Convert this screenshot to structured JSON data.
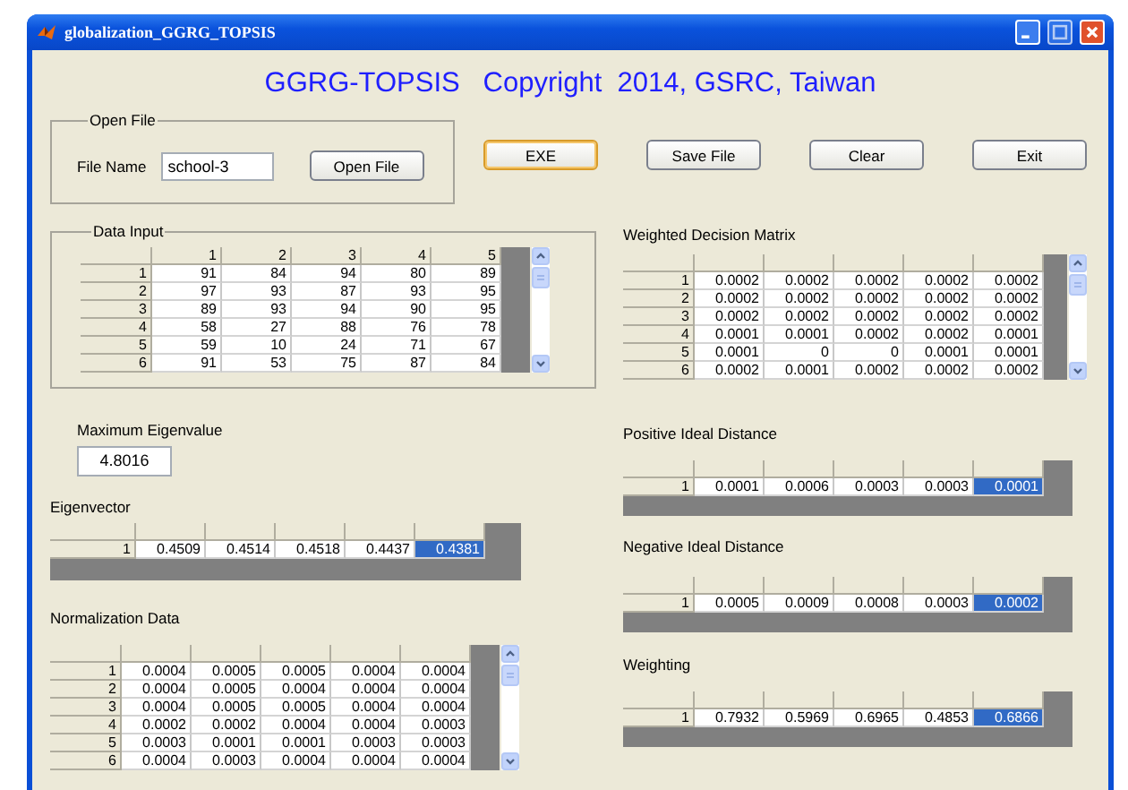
{
  "window": {
    "title": "globalization_GGRG_TOPSIS"
  },
  "heading": "GGRG-TOPSIS   Copyright  2014, GSRC, Taiwan",
  "open_file": {
    "legend": "Open File",
    "label": "File Name",
    "value": "school-3",
    "button": "Open File"
  },
  "buttons": [
    {
      "label": "EXE",
      "focused": true
    },
    {
      "label": "Save File",
      "focused": false
    },
    {
      "label": "Clear",
      "focused": false
    },
    {
      "label": "Exit",
      "focused": false
    }
  ],
  "data_input": {
    "legend": "Data Input",
    "columns": [
      "1",
      "2",
      "3",
      "4",
      "5"
    ],
    "rows": [
      {
        "label": "1",
        "cells": [
          "91",
          "84",
          "94",
          "80",
          "89"
        ]
      },
      {
        "label": "2",
        "cells": [
          "97",
          "93",
          "87",
          "93",
          "95"
        ]
      },
      {
        "label": "3",
        "cells": [
          "89",
          "93",
          "94",
          "90",
          "95"
        ]
      },
      {
        "label": "4",
        "cells": [
          "58",
          "27",
          "88",
          "76",
          "78"
        ]
      },
      {
        "label": "5",
        "cells": [
          "59",
          "10",
          "24",
          "71",
          "67"
        ]
      },
      {
        "label": "6",
        "cells": [
          "91",
          "53",
          "75",
          "87",
          "84"
        ]
      }
    ]
  },
  "weighted_decision_matrix": {
    "title": "Weighted Decision Matrix",
    "rows": [
      {
        "label": "1",
        "cells": [
          "0.0002",
          "0.0002",
          "0.0002",
          "0.0002",
          "0.0002"
        ]
      },
      {
        "label": "2",
        "cells": [
          "0.0002",
          "0.0002",
          "0.0002",
          "0.0002",
          "0.0002"
        ]
      },
      {
        "label": "3",
        "cells": [
          "0.0002",
          "0.0002",
          "0.0002",
          "0.0002",
          "0.0002"
        ]
      },
      {
        "label": "4",
        "cells": [
          "0.0001",
          "0.0001",
          "0.0002",
          "0.0002",
          "0.0001"
        ]
      },
      {
        "label": "5",
        "cells": [
          "0.0001",
          "0",
          "0",
          "0.0001",
          "0.0001"
        ]
      },
      {
        "label": "6",
        "cells": [
          "0.0002",
          "0.0001",
          "0.0002",
          "0.0002",
          "0.0002"
        ]
      }
    ]
  },
  "maximum_eigenvalue": {
    "label": "Maximum Eigenvalue",
    "value": "4.8016"
  },
  "positive_ideal_distance": {
    "title": "Positive Ideal Distance",
    "rows": [
      {
        "label": "1",
        "cells": [
          {
            "text": "0.0001",
            "selected": false
          },
          {
            "text": "0.0006",
            "selected": false
          },
          {
            "text": "0.0003",
            "selected": false
          },
          {
            "text": "0.0003",
            "selected": false
          },
          {
            "text": "0.0001",
            "selected": true
          }
        ]
      }
    ]
  },
  "eigenvector": {
    "title": "Eigenvector",
    "rows": [
      {
        "label": "1",
        "cells": [
          {
            "text": "0.4509",
            "selected": false
          },
          {
            "text": "0.4514",
            "selected": false
          },
          {
            "text": "0.4518",
            "selected": false
          },
          {
            "text": "0.4437",
            "selected": false
          },
          {
            "text": "0.4381",
            "selected": true
          }
        ]
      }
    ]
  },
  "negative_ideal_distance": {
    "title": "Negative Ideal Distance",
    "rows": [
      {
        "label": "1",
        "cells": [
          {
            "text": "0.0005",
            "selected": false
          },
          {
            "text": "0.0009",
            "selected": false
          },
          {
            "text": "0.0008",
            "selected": false
          },
          {
            "text": "0.0003",
            "selected": false
          },
          {
            "text": "0.0002",
            "selected": true
          }
        ]
      }
    ]
  },
  "normalization_data": {
    "title": "Normalization Data",
    "rows": [
      {
        "label": "1",
        "cells": [
          "0.0004",
          "0.0005",
          "0.0005",
          "0.0004",
          "0.0004"
        ]
      },
      {
        "label": "2",
        "cells": [
          "0.0004",
          "0.0005",
          "0.0004",
          "0.0004",
          "0.0004"
        ]
      },
      {
        "label": "3",
        "cells": [
          "0.0004",
          "0.0005",
          "0.0005",
          "0.0004",
          "0.0004"
        ]
      },
      {
        "label": "4",
        "cells": [
          "0.0002",
          "0.0002",
          "0.0004",
          "0.0004",
          "0.0003"
        ]
      },
      {
        "label": "5",
        "cells": [
          "0.0003",
          "0.0001",
          "0.0001",
          "0.0003",
          "0.0003"
        ]
      },
      {
        "label": "6",
        "cells": [
          "0.0004",
          "0.0003",
          "0.0004",
          "0.0004",
          "0.0004"
        ]
      }
    ]
  },
  "weighting": {
    "title": "Weighting",
    "rows": [
      {
        "label": "1",
        "cells": [
          {
            "text": "0.7932",
            "selected": false
          },
          {
            "text": "0.5969",
            "selected": false
          },
          {
            "text": "0.6965",
            "selected": false
          },
          {
            "text": "0.4853",
            "selected": false
          },
          {
            "text": "0.6866",
            "selected": true
          }
        ]
      }
    ]
  }
}
